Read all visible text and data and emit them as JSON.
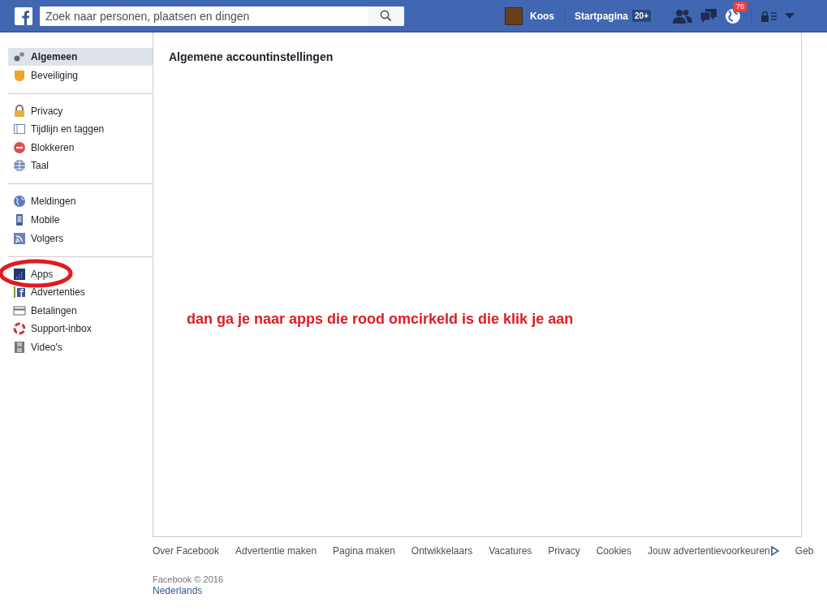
{
  "topbar": {
    "search": {
      "placeholder": "Zoek naar personen, plaatsen en dingen"
    },
    "profile_name": "Koos",
    "home": {
      "label": "Startpagina",
      "badge": "20+"
    },
    "notifications_badge": "76"
  },
  "sidebar": {
    "groups": [
      {
        "items": [
          {
            "label": "Algemeen",
            "selected": true
          },
          {
            "label": "Beveiliging",
            "selected": false
          }
        ]
      },
      {
        "items": [
          {
            "label": "Privacy",
            "selected": false
          },
          {
            "label": "Tijdlijn en taggen",
            "selected": false
          },
          {
            "label": "Blokkeren",
            "selected": false
          },
          {
            "label": "Taal",
            "selected": false
          }
        ]
      },
      {
        "items": [
          {
            "label": "Meldingen",
            "selected": false
          },
          {
            "label": "Mobile",
            "selected": false
          },
          {
            "label": "Volgers",
            "selected": false
          }
        ]
      },
      {
        "items": [
          {
            "label": "Apps",
            "selected": false
          },
          {
            "label": "Advertenties",
            "selected": false
          },
          {
            "label": "Betalingen",
            "selected": false
          },
          {
            "label": "Support-inbox",
            "selected": false
          },
          {
            "label": "Video's",
            "selected": false
          }
        ]
      }
    ]
  },
  "main": {
    "title": "Algemene accountinstellingen"
  },
  "annotation": {
    "text": "dan ga je naar apps die rood omcirkeld is die klik je aan"
  },
  "footer": {
    "links": [
      "Over Facebook",
      "Advertentie maken",
      "Pagina maken",
      "Ontwikkelaars",
      "Vacatures",
      "Privacy",
      "Cookies",
      "Jouw advertentievoorkeuren",
      "Geb"
    ],
    "copyright": "Facebook © 2016",
    "language": "Nederlands"
  }
}
